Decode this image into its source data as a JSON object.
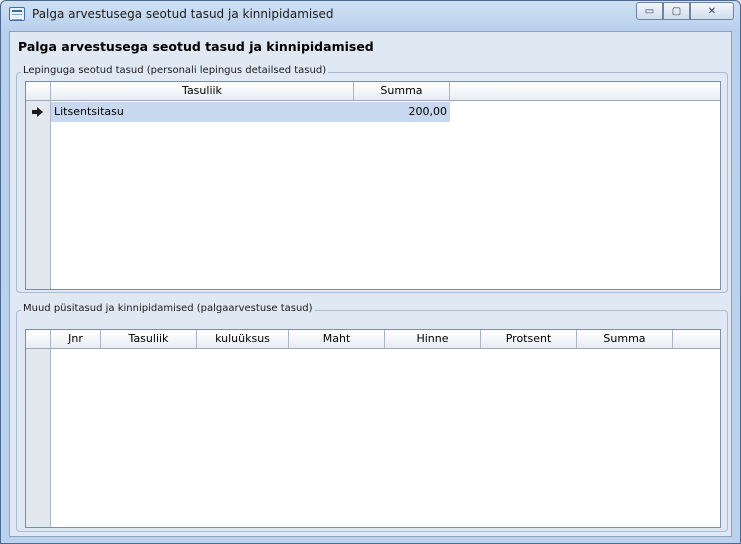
{
  "window": {
    "title": "Palga arvestusega seotud tasud ja kinnipidamised",
    "controls": {
      "minimize": "▭",
      "maximize": "▢",
      "close": "✕"
    }
  },
  "page_title": "Palga arvestusega seotud tasud ja kinnipidamised",
  "contract_fees": {
    "legend": "Lepinguga seotud tasud (personali lepingus detailsed tasud)",
    "columns": [
      "Tasuliik",
      "Summa"
    ],
    "rows": [
      {
        "tasuliik": "Litsentsitasu",
        "summa": "200,00",
        "selected": true
      }
    ]
  },
  "other_fees": {
    "legend": "Muud püsitasud ja kinnipidamised (palgaarvestuse tasud)",
    "columns": [
      "Jnr",
      "Tasuliik",
      "kuluüksus",
      "Maht",
      "Hinne",
      "Protsent",
      "Summa"
    ],
    "rows": []
  },
  "colors": {
    "selected_row": "#c8d9ef",
    "row_indicator": "#e3e8ee"
  }
}
